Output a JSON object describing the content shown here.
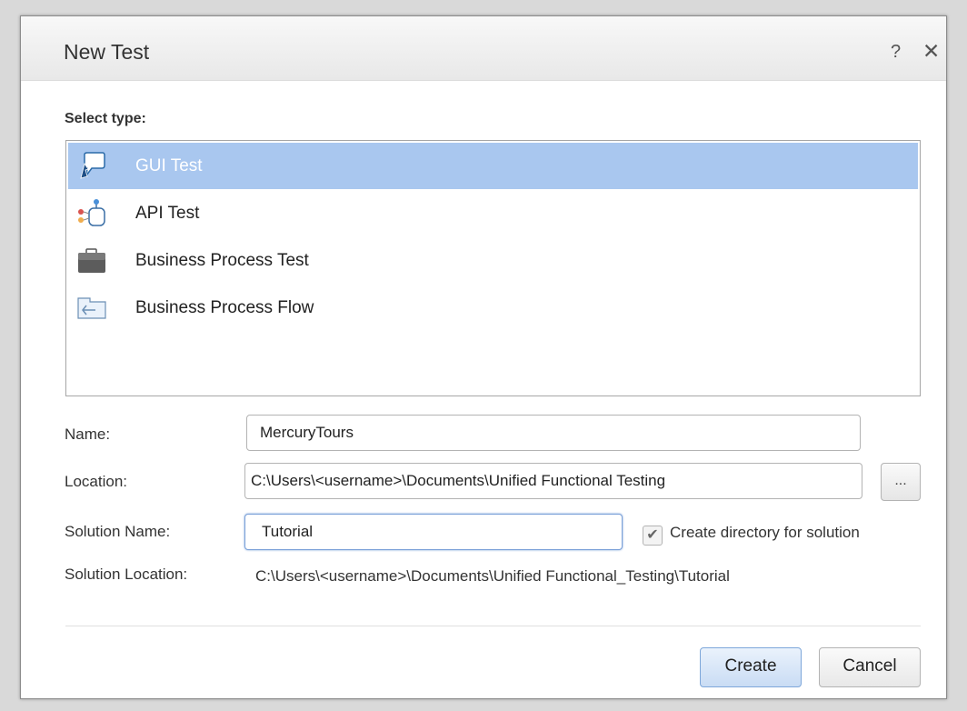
{
  "dialog": {
    "title": "New Test",
    "help_label": "?",
    "close_label": "✕"
  },
  "type_section": {
    "label": "Select type:",
    "items": [
      {
        "label": "GUI Test",
        "icon": "gui-test-icon",
        "selected": true
      },
      {
        "label": "API Test",
        "icon": "api-test-icon",
        "selected": false
      },
      {
        "label": "Business Process Test",
        "icon": "briefcase-icon",
        "selected": false
      },
      {
        "label": "Business Process Flow",
        "icon": "process-flow-icon",
        "selected": false
      }
    ]
  },
  "form": {
    "name_label": "Name:",
    "name_value": "MercuryTours",
    "location_label": "Location:",
    "location_value": "C:\\Users\\<username>\\Documents\\Unified Functional Testing",
    "browse_label": "...",
    "solution_name_label": "Solution Name:",
    "solution_name_value": "Tutorial",
    "create_directory_label": "Create directory for solution",
    "create_directory_checked": true,
    "checkmark": "✔",
    "solution_location_label": "Solution Location:",
    "solution_location_value": "C:\\Users\\<username>\\Documents\\Unified Functional_Testing\\Tutorial"
  },
  "buttons": {
    "create_label": "Create",
    "cancel_label": "Cancel"
  },
  "colors": {
    "selection": "#a9c7ef",
    "primary_button_border": "#7ea7da"
  }
}
